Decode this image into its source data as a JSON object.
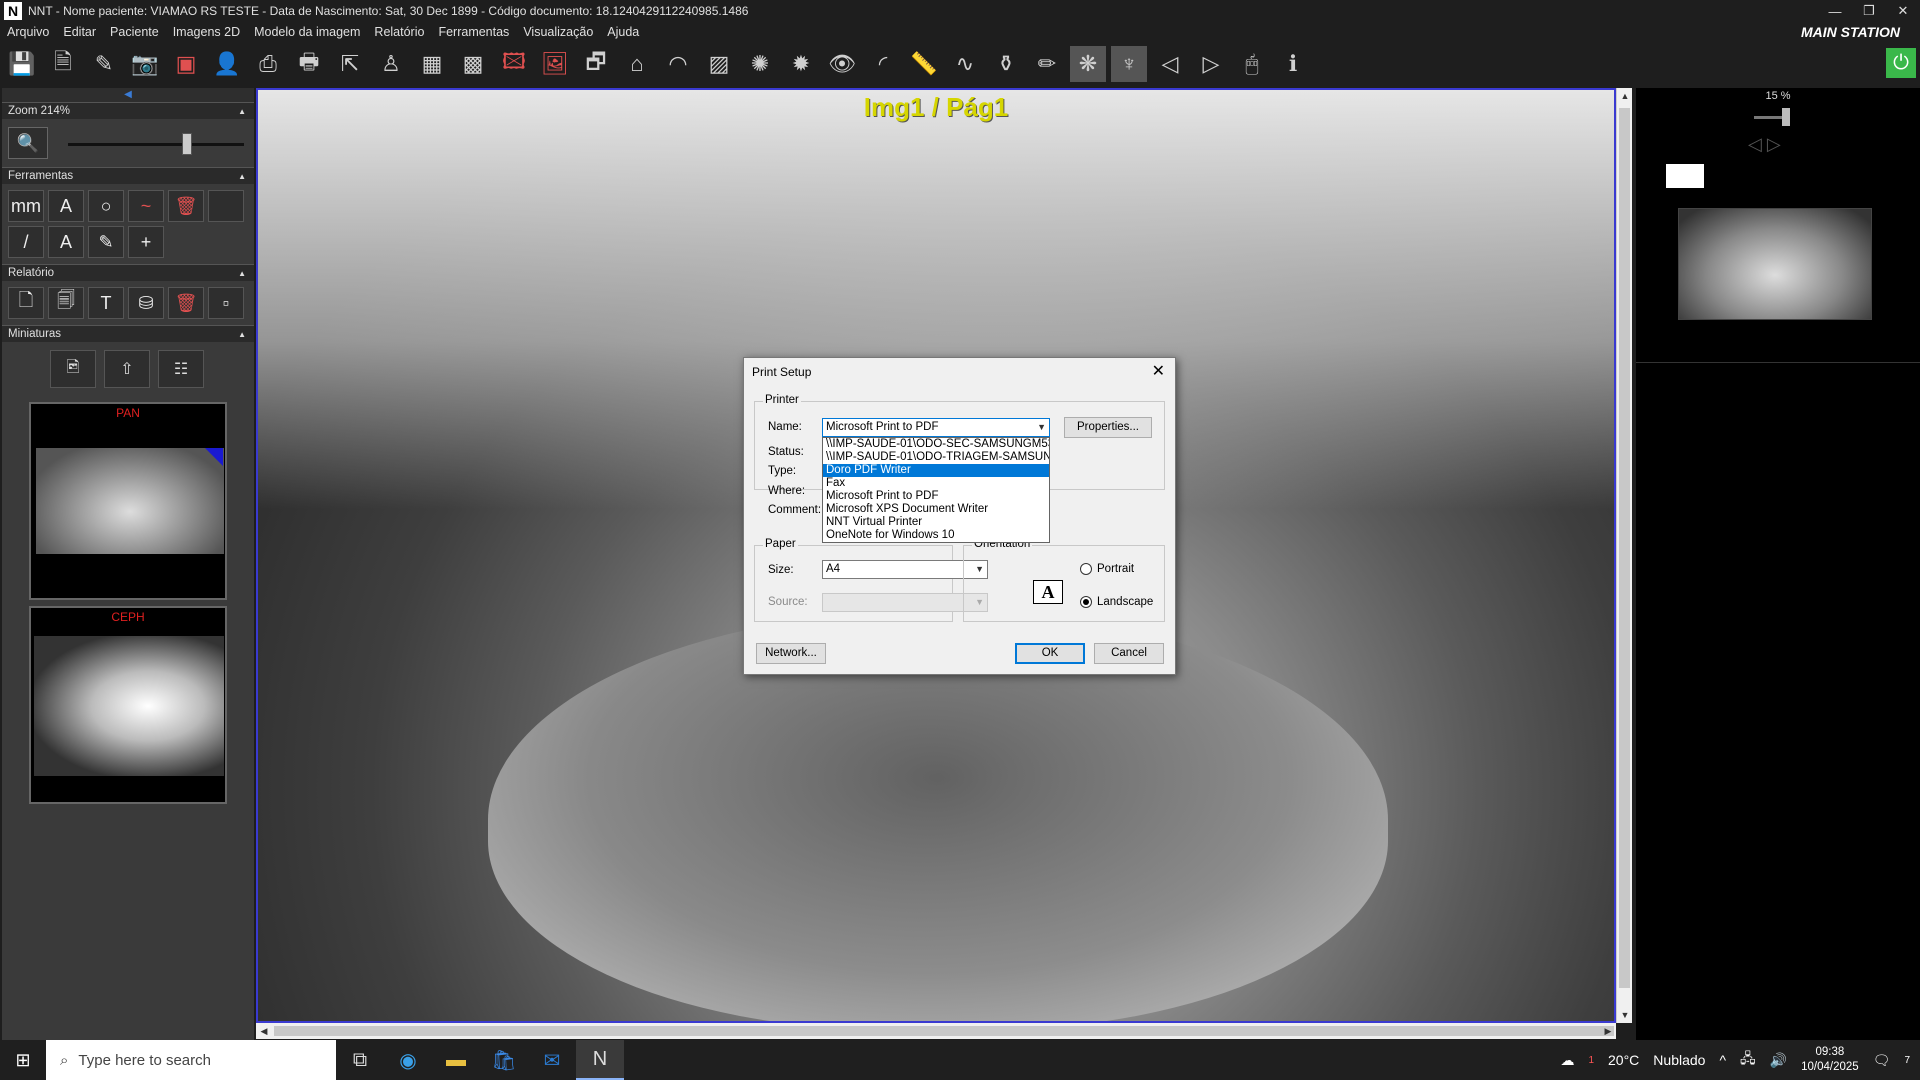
{
  "window": {
    "title": "NNT - Nome paciente: VIAMAO RS TESTE - Data de Nascimento: Sat, 30 Dec 1899 - Código documento: 18.1240429112240985.1486",
    "logo": "N",
    "station": "MAIN STATION",
    "controls": [
      "minimize-icon",
      "restore-icon",
      "close-icon"
    ]
  },
  "menu": [
    "Arquivo",
    "Editar",
    "Paciente",
    "Imagens 2D",
    "Modelo da imagem",
    "Relatório",
    "Ferramentas",
    "Visualização",
    "Ajuda"
  ],
  "left_panel": {
    "zoom_label": "Zoom 214%",
    "zoom_value_percent": 214,
    "tools_label": "Ferramentas",
    "tools": [
      "mm",
      "A",
      "○",
      "~",
      "🗑",
      "/",
      "A",
      "✎",
      "+"
    ],
    "report_label": "Relatório",
    "thumbs_label": "Miniaturas",
    "thumbnails": [
      {
        "label": "PAN"
      },
      {
        "label": "CEPH"
      }
    ]
  },
  "viewer": {
    "image_label": "Img1 / Pág1"
  },
  "right_panel": {
    "zoom": "15 %"
  },
  "dialog": {
    "title": "Print Setup",
    "printer_group": "Printer",
    "name_label": "Name:",
    "name_value": "Microsoft Print to PDF",
    "properties_button": "Properties...",
    "status_label": "Status:",
    "type_label": "Type:",
    "where_label": "Where:",
    "comment_label": "Comment:",
    "printer_options": [
      "\\\\IMP-SAUDE-01\\ODO-SEC-SAMSUNGM537",
      "\\\\IMP-SAUDE-01\\ODO-TRIAGEM-SAMSUNG",
      "Doro PDF Writer",
      "Fax",
      "Microsoft Print to PDF",
      "Microsoft XPS Document Writer",
      "NNT Virtual Printer",
      "OneNote for Windows 10"
    ],
    "highlighted_option": "Doro PDF Writer",
    "paper_group": "Paper",
    "size_label": "Size:",
    "size_value": "A4",
    "source_label": "Source:",
    "source_value": "",
    "orientation_group": "Orientation",
    "portrait_label": "Portrait",
    "landscape_label": "Landscape",
    "orientation_selected": "Landscape",
    "network_button": "Network...",
    "ok_button": "OK",
    "cancel_button": "Cancel"
  },
  "taskbar": {
    "search_placeholder": "Type here to search",
    "weather_temp": "20°C",
    "weather_text": "Nublado",
    "weather_badge": "1",
    "time": "09:38",
    "date": "10/04/2025",
    "notification_count": "7"
  },
  "colors": {
    "accent": "#0078d7",
    "image_label": "#d6d600",
    "power": "#3ab84a",
    "thumb_label": "#e02020"
  }
}
